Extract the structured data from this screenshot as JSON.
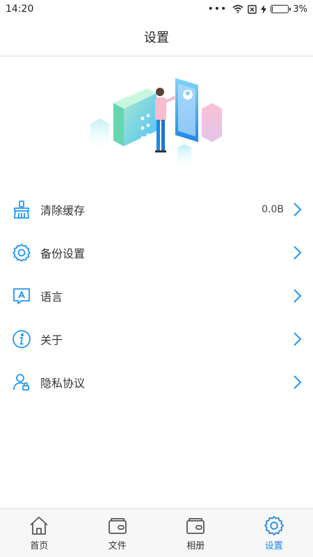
{
  "status_bar": {
    "time": "14:20",
    "battery": "3%",
    "battery_level": 0.03
  },
  "header": {
    "title": "设置"
  },
  "menu": [
    {
      "label": "清除缓存",
      "value": "0.0B",
      "icon": "broom-icon"
    },
    {
      "label": "备份设置",
      "value": "",
      "icon": "gear-icon"
    },
    {
      "label": "语言",
      "value": "",
      "icon": "language-icon"
    },
    {
      "label": "关于",
      "value": "",
      "icon": "info-icon"
    },
    {
      "label": "隐私协议",
      "value": "",
      "icon": "user-lock-icon"
    }
  ],
  "tabs": [
    {
      "label": "首页",
      "icon": "home-icon",
      "active": false
    },
    {
      "label": "文件",
      "icon": "folder-icon",
      "active": false
    },
    {
      "label": "相册",
      "icon": "album-icon",
      "active": false
    },
    {
      "label": "设置",
      "icon": "gear-icon",
      "active": true
    }
  ],
  "colors": {
    "accent": "#1e88e5",
    "icon_blue": "#2196f3",
    "divider": "#dcdcdc"
  }
}
